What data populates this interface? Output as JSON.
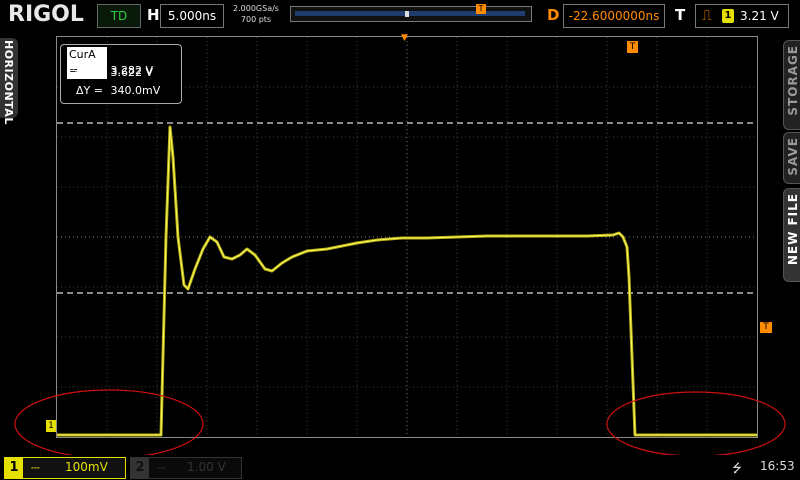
{
  "header": {
    "brand": "RIGOL",
    "run_state": "TD",
    "horizontal_label": "H",
    "timebase": "5.000ns",
    "sample_rate": "2.000GSa/s",
    "memory_depth": "700 pts",
    "delay_label": "D",
    "delay_value": "-22.6000000ns",
    "trigger_label": "T",
    "trigger_channel": "1",
    "trigger_level": "3.21 V"
  },
  "left_tab": {
    "label": "HORIZONTAL"
  },
  "right_menu": [
    {
      "label": "STORAGE"
    },
    {
      "label": "SAVE"
    },
    {
      "label": "NEW FILE"
    }
  ],
  "cursor_readout": {
    "cur_a_label": "CurA =",
    "cur_a_value": "3.282 V",
    "cur_b_label": "CurB =",
    "cur_b_value": "3.622 V",
    "delta_label": "ΔY =",
    "delta_value": "340.0mV"
  },
  "channels": {
    "ch1": {
      "number": "1",
      "coupling": "⎓",
      "scale": "100mV",
      "color": "#e5e000"
    },
    "ch2": {
      "number": "2",
      "coupling": "⎓",
      "scale": "1.00 V",
      "color": "#333333"
    }
  },
  "status": {
    "time": "16:53",
    "usb_icon": "usb-icon"
  },
  "markers": {
    "trigger_marker": "T",
    "trigger_level_marker": "T",
    "ch1_ground_marker": "1"
  }
}
